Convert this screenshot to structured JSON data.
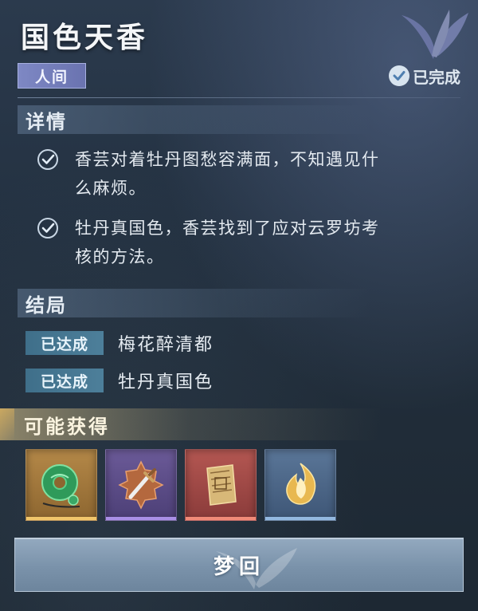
{
  "header": {
    "title": "国色天香",
    "realm_badge": "人间",
    "status": "已完成"
  },
  "details": {
    "heading": "详情",
    "items": [
      {
        "text_line1": "香芸对着牡丹图愁容满面，不知遇见什",
        "text_line2": "么麻烦。",
        "checked": true
      },
      {
        "text_line1": "牡丹真国色，香芸找到了应对云罗坊考",
        "text_line2": "核的方法。",
        "checked": true
      }
    ]
  },
  "endings": {
    "heading": "结局",
    "items": [
      {
        "tag": "已达成",
        "name": "梅花醉清都"
      },
      {
        "tag": "已达成",
        "name": "牡丹真国色"
      }
    ]
  },
  "rewards": {
    "heading": "可能获得",
    "items": [
      {
        "icon": "jade-pendant-icon",
        "rarity_color": "#f1c66b"
      },
      {
        "icon": "dagger-icon",
        "rarity_color": "#a98fe6"
      },
      {
        "icon": "book-icon",
        "rarity_color": "#f08a78"
      },
      {
        "icon": "golden-flame-icon",
        "rarity_color": "#93b8e0"
      }
    ]
  },
  "action": {
    "button_label": "梦回"
  }
}
